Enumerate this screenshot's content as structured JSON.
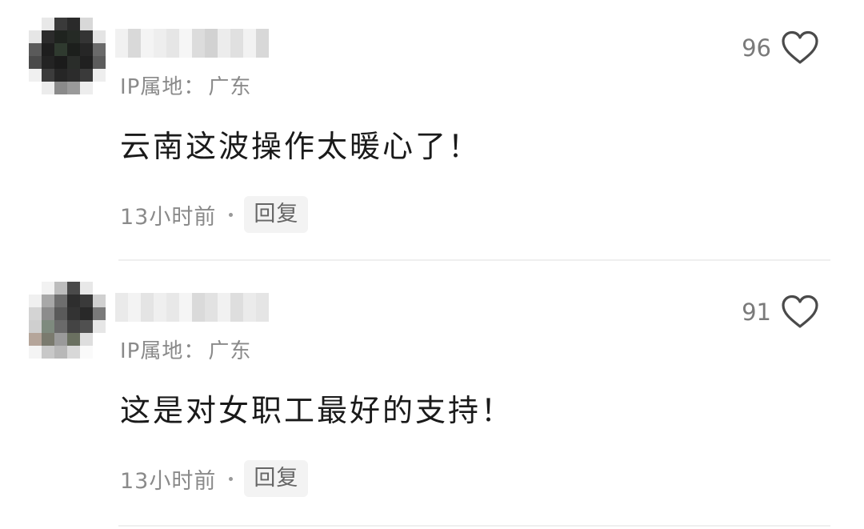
{
  "comments": [
    {
      "username": "",
      "ip_label": "IP属地",
      "ip_location": "广东",
      "likes": "96",
      "content": "云南这波操作太暖心了！",
      "time": "13小时前",
      "reply_label": "回复"
    },
    {
      "username": "",
      "ip_label": "IP属地",
      "ip_location": "广东",
      "likes": "91",
      "content": "这是对女职工最好的支持！",
      "time": "13小时前",
      "reply_label": "回复"
    }
  ],
  "separator": "：",
  "colors": {
    "text_primary": "#1a1a1a",
    "text_secondary": "#8a8a8a",
    "reply_bg": "#f3f3f3",
    "divider": "#efefef"
  },
  "icons": {
    "like": "heart-outline-icon"
  }
}
